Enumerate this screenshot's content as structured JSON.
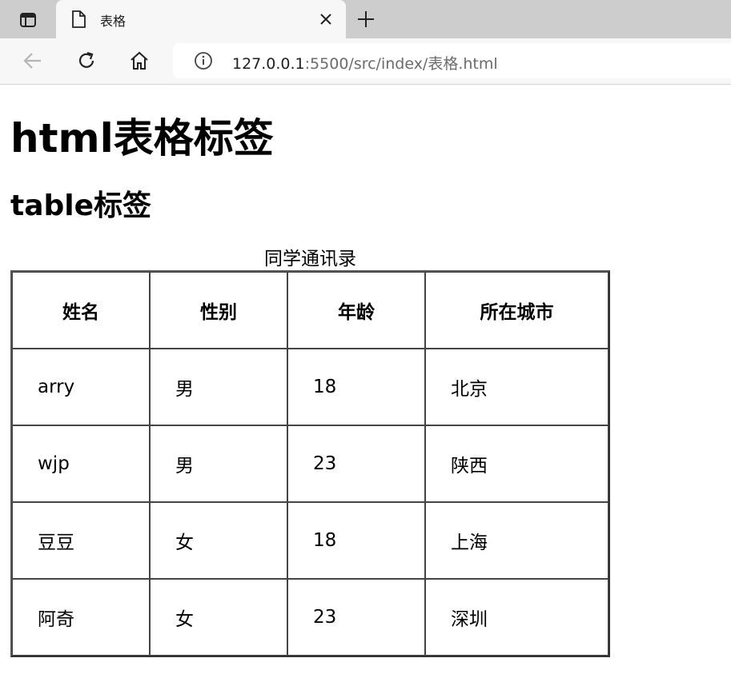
{
  "browser": {
    "tab_title": "表格",
    "url_host": "127.0.0.1",
    "url_rest": ":5500/src/index/表格.html"
  },
  "page": {
    "h1": "html表格标签",
    "h2": "table标签",
    "caption": "同学通讯录",
    "headers": [
      "姓名",
      "性别",
      "年龄",
      "所在城市"
    ],
    "rows": [
      [
        "arry",
        "男",
        "18",
        "北京"
      ],
      [
        "wjp",
        "男",
        "23",
        "陕西"
      ],
      [
        "豆豆",
        "女",
        "18",
        "上海"
      ],
      [
        "阿奇",
        "女",
        "23",
        "深圳"
      ]
    ]
  }
}
